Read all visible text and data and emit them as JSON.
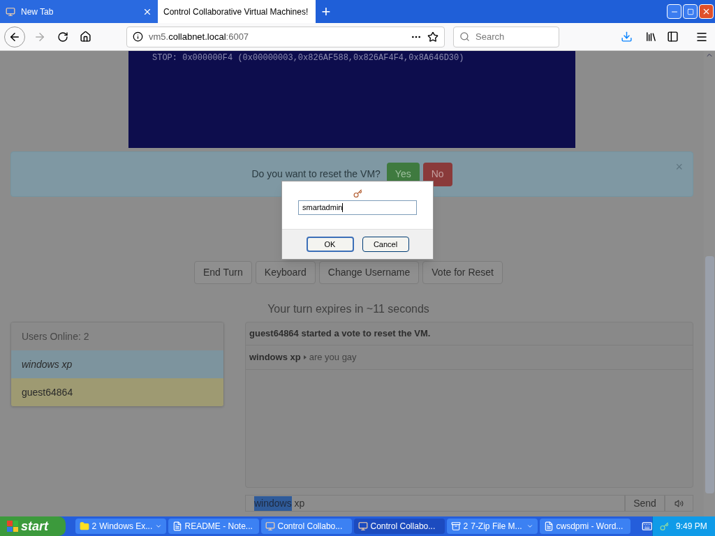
{
  "browser": {
    "tabs": [
      {
        "title": "New Tab",
        "selected": false
      },
      {
        "title": "Control Collaborative Virtual Machines!",
        "selected": true
      }
    ],
    "new_tab": "+",
    "url": {
      "prefix": "vm5.",
      "domain": "collabnet.local",
      "port": ":6007"
    },
    "search": {
      "placeholder": "Search"
    }
  },
  "page": {
    "vm_screen": {
      "text": "STOP: 0x000000F4 (0x00000003,0x826AF588,0x826AF4F4,0x8A646D30)"
    },
    "vote_alert": {
      "text": "Do you want to reset the VM?",
      "yes": "Yes",
      "no": "No",
      "close": "×"
    },
    "buttons": [
      "End Turn",
      "Keyboard",
      "Change Username",
      "Vote for Reset"
    ],
    "turn_text": "Your turn expires in ~11 seconds",
    "users": {
      "header": "Users Online: 2",
      "list": [
        {
          "name": "windows xp",
          "self": true,
          "color": "#7d949e"
        },
        {
          "name": "guest64864",
          "self": false,
          "color": "#9e9a72"
        }
      ]
    },
    "chat": {
      "messages": [
        {
          "kind": "system",
          "text": "guest64864 started a vote to reset the VM."
        },
        {
          "kind": "user",
          "user": "windows xp",
          "text": "are you gay"
        }
      ],
      "input": {
        "selected_part": "windows",
        "rest": " xp"
      },
      "send": "Send"
    }
  },
  "dialog": {
    "value": "smartadmin",
    "ok": "OK",
    "cancel": "Cancel"
  },
  "taskbar": {
    "start": "start",
    "items": [
      {
        "label": "Windows Ex...",
        "count": "2",
        "kind": "folder",
        "selected": false
      },
      {
        "label": "README - Note...",
        "kind": "document",
        "selected": false
      },
      {
        "label": "Control Collabo...",
        "kind": "app",
        "selected": false
      },
      {
        "label": "Control Collabo...",
        "kind": "app",
        "selected": true
      },
      {
        "label": "7-Zip File M...",
        "count": "2",
        "kind": "archive",
        "selected": false
      },
      {
        "label": "cwsdpmi - Word...",
        "kind": "document",
        "selected": false
      }
    ],
    "clock": "9:49 PM"
  }
}
